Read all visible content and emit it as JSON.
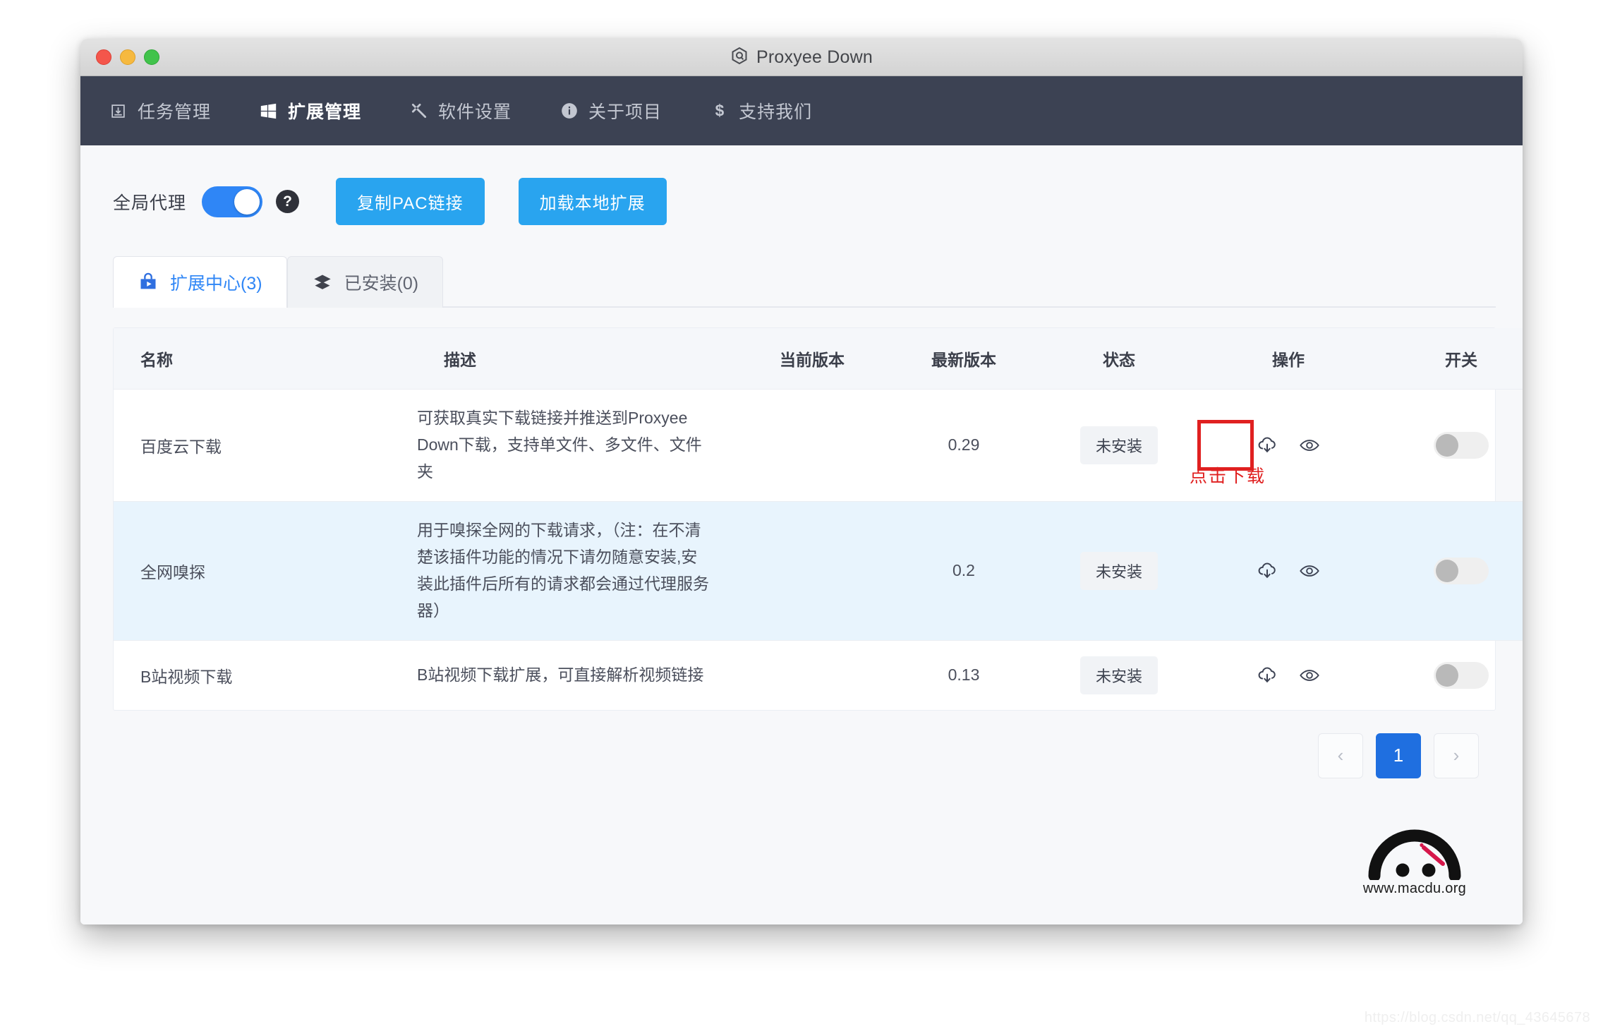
{
  "window": {
    "title": "Proxyee Down",
    "title_icon": "hexagon-logo-icon",
    "traffic_lights": [
      "close",
      "minimize",
      "zoom"
    ]
  },
  "nav": {
    "items": [
      {
        "label": "任务管理",
        "icon": "task-download-icon",
        "active": false
      },
      {
        "label": "扩展管理",
        "icon": "windows-icon",
        "active": true
      },
      {
        "label": "软件设置",
        "icon": "tools-icon",
        "active": false
      },
      {
        "label": "关于项目",
        "icon": "info-icon",
        "active": false
      },
      {
        "label": "支持我们",
        "icon": "dollar-icon",
        "active": false
      }
    ]
  },
  "toolbar": {
    "proxy_label": "全局代理",
    "proxy_enabled": true,
    "help_glyph": "?",
    "copy_pac_label": "复制PAC链接",
    "load_local_label": "加载本地扩展",
    "button_color": "#29a4ef",
    "switch_on_color": "#2f86f6"
  },
  "tabs": [
    {
      "label": "扩展中心(3)",
      "icon": "extension-store-icon",
      "active": true
    },
    {
      "label": "已安装(0)",
      "icon": "layers-icon",
      "active": false
    }
  ],
  "table": {
    "headers": [
      "名称",
      "描述",
      "当前版本",
      "最新版本",
      "状态",
      "操作",
      "开关"
    ],
    "rows": [
      {
        "name": "百度云下载",
        "desc": "可获取真实下载链接并推送到Proxyee Down下载，支持单文件、多文件、文件夹",
        "current_version": "",
        "latest_version": "0.29",
        "status": "未安装",
        "actions": [
          "cloud-download-icon",
          "eye-icon"
        ],
        "switch_on": false,
        "striped": false,
        "highlighted_action": true
      },
      {
        "name": "全网嗅探",
        "desc": "用于嗅探全网的下载请求，（注：在不清楚该插件功能的情况下请勿随意安装,安装此插件后所有的请求都会通过代理服务器）",
        "current_version": "",
        "latest_version": "0.2",
        "status": "未安装",
        "actions": [
          "cloud-download-icon",
          "eye-icon"
        ],
        "switch_on": false,
        "striped": true,
        "highlighted_action": false
      },
      {
        "name": "B站视频下载",
        "desc": "B站视频下载扩展，可直接解析视频链接",
        "current_version": "",
        "latest_version": "0.13",
        "status": "未安装",
        "actions": [
          "cloud-download-icon",
          "eye-icon"
        ],
        "switch_on": false,
        "striped": false,
        "highlighted_action": false
      }
    ]
  },
  "annotation": {
    "text": "点击下载",
    "color": "#e02020"
  },
  "pagination": {
    "prev_glyph": "‹",
    "current_page": "1",
    "next_glyph": "›",
    "active_color": "#1f6fe0"
  },
  "watermarks": {
    "site_label": "www.macdu.org",
    "blog_url": "https://blog.csdn.net/qq_43645678"
  }
}
